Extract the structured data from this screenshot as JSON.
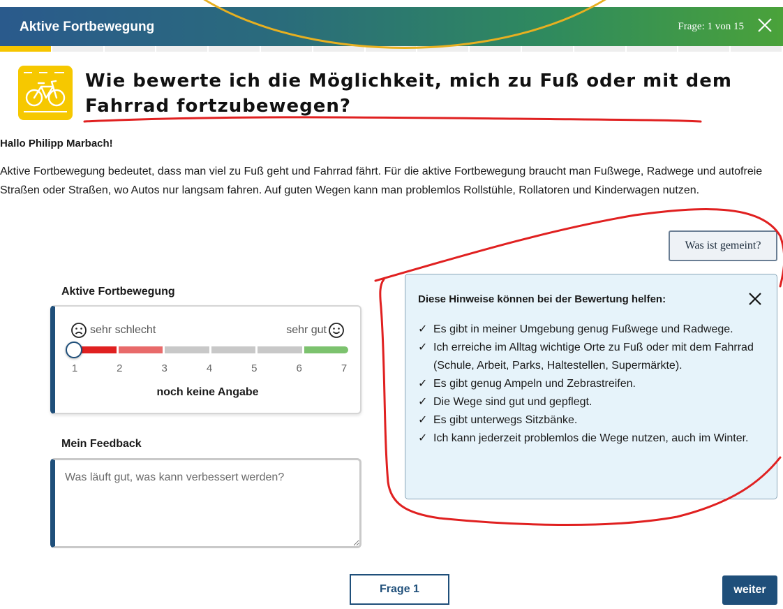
{
  "header": {
    "title": "Aktive Fortbewegung",
    "counter": "Frage: 1 von 15",
    "progress": {
      "current": 1,
      "total": 15
    }
  },
  "question": {
    "icon": "bicycle-icon",
    "title": "Wie bewerte ich die Möglichkeit, mich zu Fuß oder mit dem Fahrrad fortzubewegen?"
  },
  "greeting": "Hallo Philipp Marbach!",
  "intro": "Aktive Fortbewegung bedeutet, dass man viel zu Fuß geht und Fahrrad fährt. Für die aktive Fortbewegung braucht man Fußwege, Radwege und autofreie Straßen oder Straßen, wo Autos nur langsam fahren. Auf guten Wegen kann man problemlos Rollstühle, Rollatoren und Kinderwagen nutzen.",
  "meaning_button": "Was ist gemeint?",
  "rating": {
    "label": "Aktive Fortbewegung",
    "low_label": "sehr schlecht",
    "high_label": "sehr gut",
    "ticks": [
      "1",
      "2",
      "3",
      "4",
      "5",
      "6",
      "7"
    ],
    "status": "noch keine Angabe",
    "value": null,
    "segment_colors": [
      "#e02020",
      "#e86a6a",
      "#c8c8c8",
      "#c8c8c8",
      "#c8c8c8",
      "#7cc26e",
      "#3aa83a"
    ]
  },
  "feedback": {
    "label": "Mein Feedback",
    "placeholder": "Was läuft gut, was kann verbessert werden?",
    "value": ""
  },
  "hints": {
    "title": "Diese Hinweise können bei der Bewertung helfen:",
    "check": "✓",
    "items": [
      "Es gibt in meiner Umgebung genug Fußwege und Radwege.",
      "Ich erreiche im Alltag wichtige Orte zu Fuß oder mit dem Fahrrad (Schule, Arbeit, Parks, Haltestellen, Supermärkte).",
      "Es gibt genug Ampeln und Zebrastreifen.",
      "Die Wege sind gut und gepflegt.",
      "Es gibt unterwegs Sitzbänke.",
      "Ich kann jederzeit problemlos die Wege nutzen, auch im Winter."
    ]
  },
  "footer": {
    "frage_button": "Frage 1",
    "next_button": "weiter"
  },
  "colors": {
    "accent": "#1f4f7a",
    "progress_active": "#f6c500",
    "icon_bg": "#f6c800",
    "hints_bg": "#e6f3fa",
    "annotation_red": "#e02020",
    "annotation_orange": "#e8b020"
  }
}
